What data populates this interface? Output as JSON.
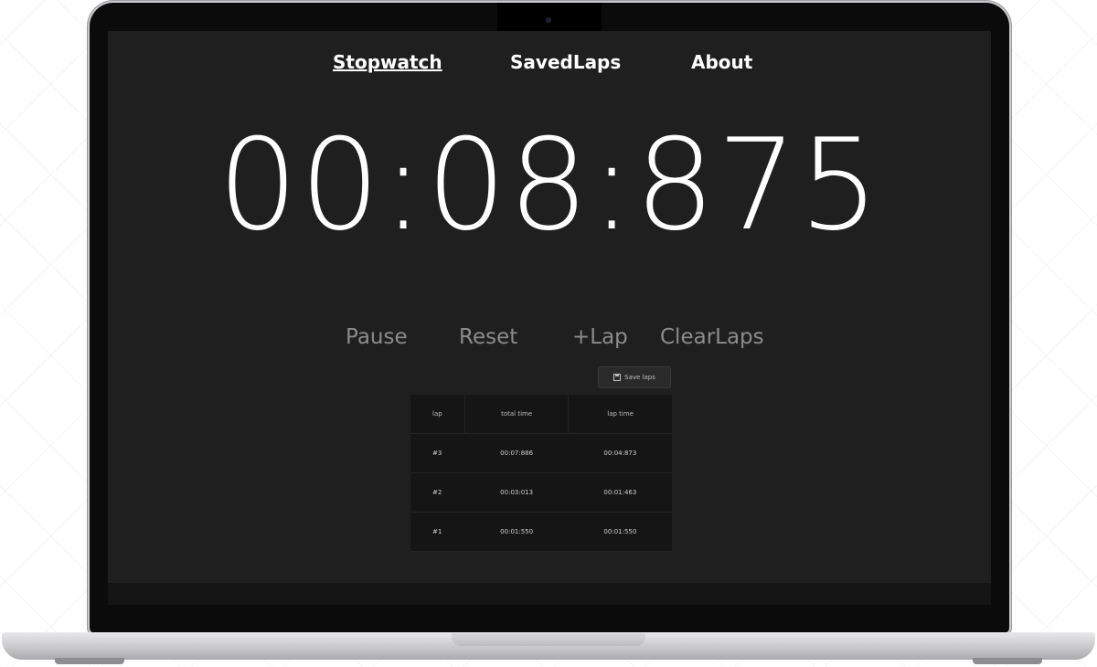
{
  "nav": {
    "items": [
      {
        "label": "Stopwatch",
        "active": true
      },
      {
        "label": "SavedLaps",
        "active": false
      },
      {
        "label": "About",
        "active": false
      }
    ]
  },
  "timer": {
    "display": "00:08:875"
  },
  "controls": {
    "pause_label": "Pause",
    "reset_label": "Reset",
    "lap_label": "+Lap",
    "clear_label": "ClearLaps"
  },
  "save_laps": {
    "label": "Save laps"
  },
  "laps_table": {
    "headers": [
      "lap",
      "total time",
      "lap time"
    ],
    "rows": [
      [
        "#3",
        "00:07:886",
        "00:04:873"
      ],
      [
        "#2",
        "00:03:013",
        "00:01:463"
      ],
      [
        "#1",
        "00:01:550",
        "00:01:550"
      ]
    ]
  },
  "colors": {
    "screen_background": "#1f1f1f",
    "primary_text": "#ffffff",
    "muted_controls": "#8c8c8c",
    "table_background": "#151515"
  }
}
